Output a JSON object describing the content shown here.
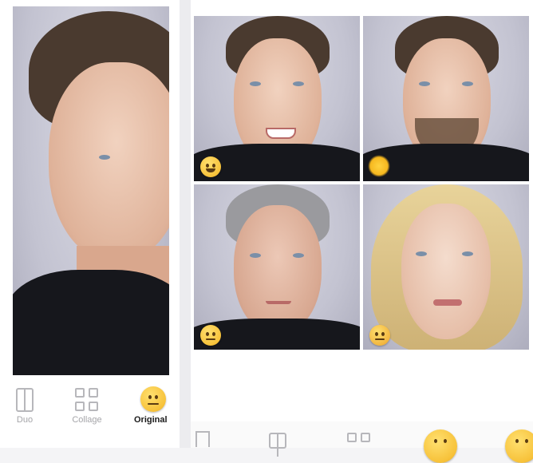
{
  "left_panel": {
    "tabs": [
      {
        "label": "Duo",
        "icon": "duo-icon"
      },
      {
        "label": "Collage",
        "icon": "collage-icon"
      },
      {
        "label": "Original",
        "icon": "neutral-face-emoji-icon"
      }
    ]
  },
  "right_panel": {
    "grid": [
      {
        "filter": "smile",
        "icon": "grinning-face-emoji-icon"
      },
      {
        "filter": "beard",
        "icon": "sun-emoji-icon"
      },
      {
        "filter": "old",
        "icon": "old-man-emoji-icon"
      },
      {
        "filter": "female",
        "icon": "woman-emoji-icon"
      }
    ],
    "bottom_icons": [
      "edit-icon",
      "duo-icon",
      "collage-icon",
      "neutral-face-emoji-icon",
      "emoji-icon"
    ]
  },
  "colors": {
    "emoji_yellow": "#f7c23a",
    "inactive_label": "#a5a5a9",
    "active_label": "#1a1a1a"
  }
}
